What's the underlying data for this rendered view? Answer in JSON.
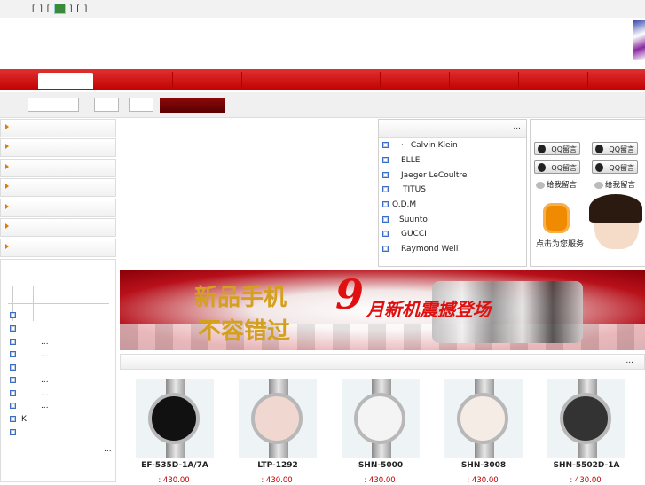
{
  "topbar": {
    "links_text": "[ ]  [",
    "links_tail": "]  [ ]"
  },
  "search": {
    "keyword_value": "",
    "field2_value": "",
    "field3_value": ""
  },
  "left_categories": [
    "",
    "",
    "",
    "",
    "",
    "",
    ""
  ],
  "left_list": [
    {
      "text": "",
      "bullet": true
    },
    {
      "text": "",
      "bullet": true
    },
    {
      "text": "...",
      "bullet": true
    },
    {
      "text": "...",
      "bullet": true
    },
    {
      "text": "",
      "bullet": true
    },
    {
      "text": "...",
      "bullet": true
    },
    {
      "text": "...",
      "bullet": true
    },
    {
      "text": "...",
      "bullet": true
    },
    {
      "text": "K",
      "bullet": true
    },
    {
      "text": "",
      "bullet": true
    }
  ],
  "left_more": "...",
  "brands": {
    "more": "...",
    "items": [
      {
        "dot": "·",
        "label": "Calvin Klein"
      },
      {
        "dot": "",
        "label": "ELLE"
      },
      {
        "dot": "",
        "label": "Jaeger LeCoultre"
      },
      {
        "dot": "",
        "label": "TITUS"
      },
      {
        "dot": "",
        "label": "O.D.M"
      },
      {
        "dot": "",
        "label": "Suunto"
      },
      {
        "dot": "",
        "label": "GUCCI"
      },
      {
        "dot": "",
        "label": "Raymond Weil"
      }
    ]
  },
  "service": {
    "qq_label": "QQ留言",
    "msg_label": "给我留言",
    "call_text": "点击为您服务"
  },
  "banner": {
    "line1": "新品手机",
    "line2": "不容错过",
    "nine": "9",
    "right": "月新机震撼登场"
  },
  "products_header": {
    "more": "..."
  },
  "products": [
    {
      "name": "EF-535D-1A/7A",
      "price": ": 430.00"
    },
    {
      "name": "LTP-1292",
      "price": ": 430.00"
    },
    {
      "name": "SHN-5000",
      "price": ": 430.00"
    },
    {
      "name": "SHN-3008",
      "price": ": 430.00"
    },
    {
      "name": "SHN-5502D-1A",
      "price": ": 430.00"
    }
  ]
}
